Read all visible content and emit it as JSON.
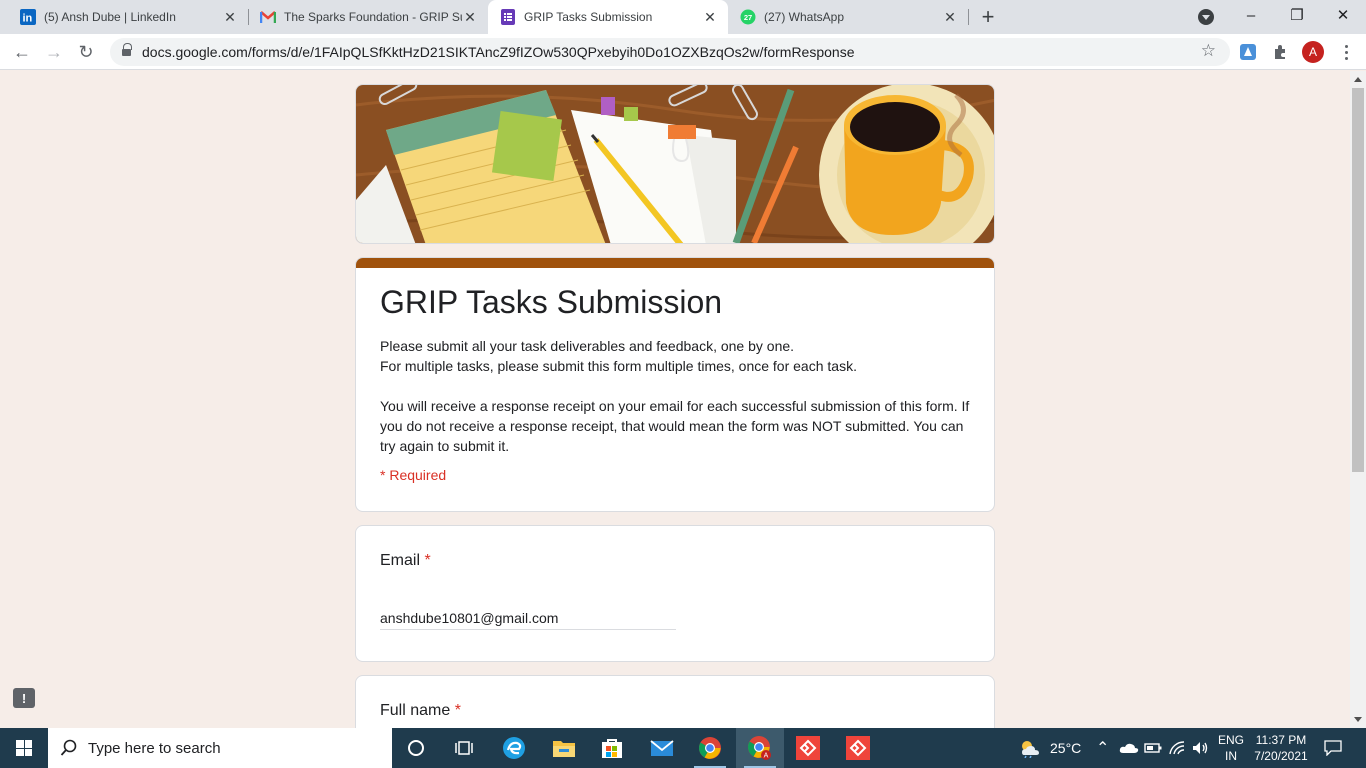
{
  "browser": {
    "tabs": [
      {
        "title": "(5) Ansh Dube | LinkedIn",
        "icon": "linkedin-icon",
        "active": false
      },
      {
        "title": "The Sparks Foundation - GRIP Submission",
        "icon": "gmail-icon",
        "active": false
      },
      {
        "title": "GRIP Tasks Submission",
        "icon": "google-forms-icon",
        "active": true
      },
      {
        "title": "(27) WhatsApp",
        "icon": "whatsapp-icon",
        "badge": "27",
        "active": false
      }
    ],
    "url": "docs.google.com/forms/d/e/1FAIpQLSfKktHzD21SIKTAncZ9fIZOw530QPxebyih0Do1OZXBzqOs2w/formResponse",
    "profile_initial": "A",
    "window_controls": {
      "minimize": "–",
      "restore": "❐",
      "close": "✕"
    }
  },
  "form": {
    "title": "GRIP Tasks Submission",
    "description": "Please submit all your task deliverables and feedback, one by one.\nFor multiple tasks, please submit this form multiple times, once for each task.\n\nYou will receive a response receipt on your email for each successful submission of this form. If you do not receive a response receipt, that would mean the form was NOT submitted. You can try again to submit it.",
    "required_note": "* Required",
    "accent_color": "#a0520c",
    "questions": [
      {
        "label": "Email",
        "required": true,
        "value": "anshdube10801@gmail.com"
      },
      {
        "label": "Full name",
        "required": true,
        "value": ""
      }
    ],
    "required_marker": "*"
  },
  "taskbar": {
    "search_placeholder": "Type here to search",
    "weather": "25°C",
    "language": "ENG",
    "region": "IN",
    "time": "11:37 PM",
    "date": "7/20/2021"
  }
}
